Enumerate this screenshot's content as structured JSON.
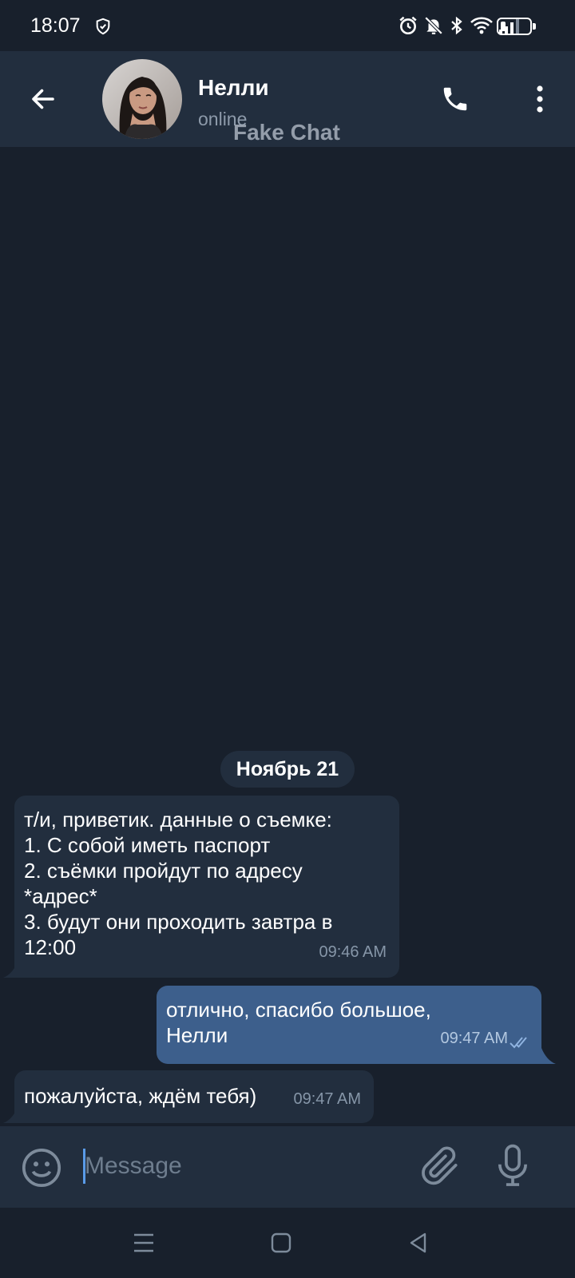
{
  "status_bar": {
    "time": "18:07",
    "battery_level": 0.2
  },
  "header": {
    "contact_name": "Нелли",
    "contact_status": "online",
    "watermark": "Fake Chat",
    "back_icon": "arrow-left-icon",
    "call_icon": "phone-icon",
    "menu_icon": "more-vertical-icon"
  },
  "chat": {
    "date_label": "Ноябрь 21",
    "messages": [
      {
        "direction": "incoming",
        "text": "т/и, приветик. данные о съемке:\n1. С собой иметь паспорт\n2. съёмки пройдут по адресу\n*адрес*\n3. будут они проходить завтра в\n12:00",
        "time": "09:46 AM"
      },
      {
        "direction": "outgoing",
        "text": "отлично, спасибо большое,\nНелли",
        "time": "09:47 AM",
        "read": true
      },
      {
        "direction": "incoming",
        "text": "пожалуйста, ждём тебя)",
        "time": "09:47 AM"
      }
    ]
  },
  "input_bar": {
    "placeholder": "Message",
    "emoji_icon": "smile-icon",
    "attach_icon": "paperclip-icon",
    "mic_icon": "microphone-icon"
  },
  "colors": {
    "background": "#18202c",
    "header": "#222e3e",
    "incoming_bubble": "#222e3e",
    "outgoing_bubble": "#3d5f8c",
    "accent": "#5a9be8"
  }
}
